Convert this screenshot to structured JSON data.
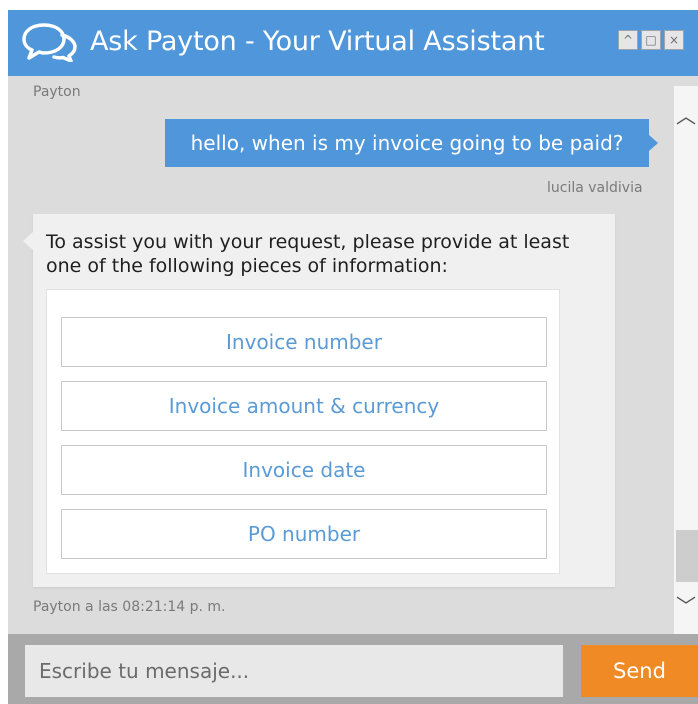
{
  "header": {
    "title": "Ask Payton - Your Virtual Assistant",
    "icon": "chat-bubbles-icon",
    "controls": [
      {
        "name": "minimize",
        "glyph": "^"
      },
      {
        "name": "maximize",
        "glyph": "□"
      },
      {
        "name": "close",
        "glyph": "×"
      }
    ]
  },
  "conversation": {
    "top_sender": "Payton",
    "user_message": {
      "text": "hello, when is my invoice going to be paid?",
      "sender": "lucila valdivia"
    },
    "bot_message": {
      "text": "To assist you with your request, please provide at least one of the following pieces of information:",
      "options": [
        "Invoice number",
        "Invoice amount & currency",
        "Invoice date",
        "PO number"
      ],
      "timestamp": "Payton a las 08:21:14 p. m."
    }
  },
  "scrollbar": {
    "up_glyph": "︿",
    "down_glyph": "﹀"
  },
  "composer": {
    "placeholder": "Escribe tu mensaje...",
    "send_label": "Send"
  },
  "colors": {
    "brand_blue": "#4f96da",
    "send_orange": "#f08a24",
    "option_text": "#5b9bd5"
  }
}
